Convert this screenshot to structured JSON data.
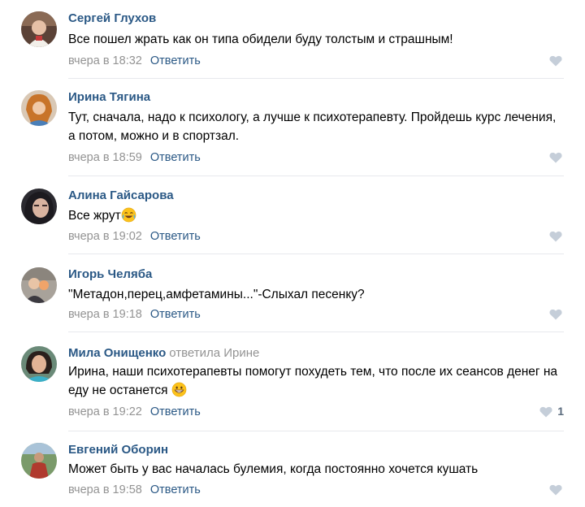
{
  "colors": {
    "author_link": "#2a5885",
    "secondary_text": "#939393",
    "divider": "#e7e8ec",
    "like_icon": "#c5ced9"
  },
  "comments": [
    {
      "author": "Сергей Глухов",
      "text": "Все пошел жрать как он типа обидели буду толстым и страшным!",
      "date": "вчера в 18:32",
      "reply": "Ответить",
      "avatar_icon": "user-avatar"
    },
    {
      "author": "Ирина Тягина",
      "text": "Тут, сначала, надо к психологу, а лучше к психотерапевту. Пройдешь курс лечения, а потом, можно и в спортзал.",
      "date": "вчера в 18:59",
      "reply": "Ответить",
      "avatar_icon": "user-avatar"
    },
    {
      "author": "Алина Гайсарова",
      "text": "Все жрут",
      "emoji": "tears-of-joy-emoji",
      "date": "вчера в 19:02",
      "reply": "Ответить",
      "avatar_icon": "user-avatar"
    },
    {
      "author": "Игорь Челяба",
      "text": "\"Метадон,перец,амфетамины...\"-Слыхал песенку?",
      "date": "вчера в 19:18",
      "reply": "Ответить",
      "avatar_icon": "user-avatar"
    },
    {
      "author": "Мила Онищенко",
      "replied_to": "ответила Ирине",
      "text": "Ирина, наши психотерапевты помогут похудеть тем, что после их сеансов денег на еду не останется",
      "emoji": "grinning-emoji",
      "date": "вчера в 19:22",
      "reply": "Ответить",
      "likes": "1",
      "avatar_icon": "user-avatar"
    },
    {
      "author": "Евгений Оборин",
      "text": "Может быть у вас началась булемия, когда постоянно хочется кушать",
      "date": "вчера в 19:58",
      "reply": "Ответить",
      "avatar_icon": "user-avatar"
    }
  ]
}
